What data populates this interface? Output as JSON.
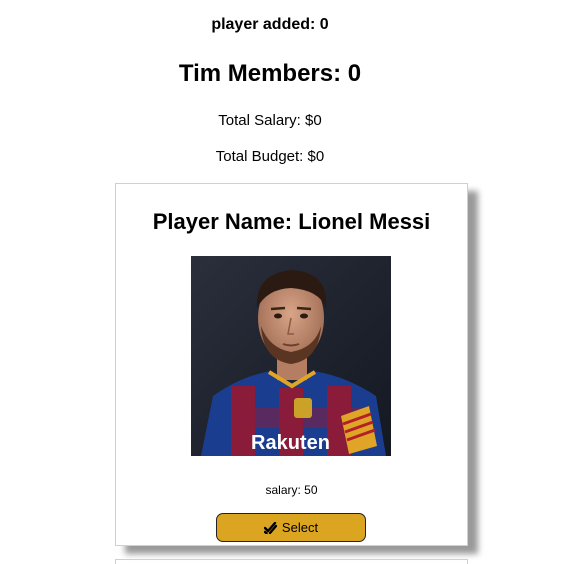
{
  "header": {
    "players_added": "player added: 0",
    "team_members": "Tim Members: 0",
    "total_salary": "Total Salary: $0",
    "total_budget": "Total Budget: $0"
  },
  "players": [
    {
      "title": "Player Name: Lionel Messi",
      "photo_alt": "Lionel Messi",
      "salary": "salary: 50",
      "select_label": "Select",
      "select_icon": "double-check-icon"
    }
  ],
  "colors": {
    "select_button": "#dba521",
    "card_shadow": "#9a9a9a"
  }
}
